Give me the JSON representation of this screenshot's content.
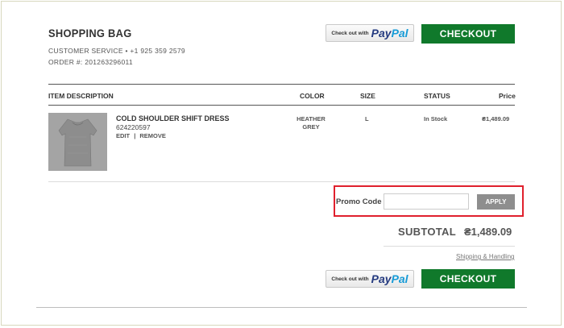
{
  "header": {
    "title": "SHOPPING BAG",
    "customer_service": "CUSTOMER SERVICE • +1 925 359 2579",
    "order_number": "ORDER #: 201263296011"
  },
  "paypal": {
    "prefix": "Check out with",
    "logo_pay": "Pay",
    "logo_pal": "Pal"
  },
  "checkout_label": "CHECKOUT",
  "table": {
    "columns": [
      "ITEM DESCRIPTION",
      "COLOR",
      "SIZE",
      "STATUS",
      "Price"
    ],
    "items": [
      {
        "name": "COLD SHOULDER SHIFT DRESS",
        "sku": "624220597",
        "edit": "EDIT",
        "separator": "|",
        "remove": "REMOVE",
        "color_line1": "HEATHER",
        "color_line2": "GREY",
        "size": "L",
        "status": "In Stock",
        "price": "₴1,489.09"
      }
    ]
  },
  "promo": {
    "label": "Promo Code",
    "value": "",
    "placeholder": "",
    "apply_label": "APPLY",
    "highlight_color": "#e0202d"
  },
  "subtotal": {
    "label": "SUBTOTAL",
    "value": "₴1,489.09"
  },
  "shipping_link": "Shipping & Handling",
  "colors": {
    "checkout_green": "#10792b",
    "paypal_blue_dark": "#253b80",
    "paypal_blue_light": "#179bd7"
  }
}
